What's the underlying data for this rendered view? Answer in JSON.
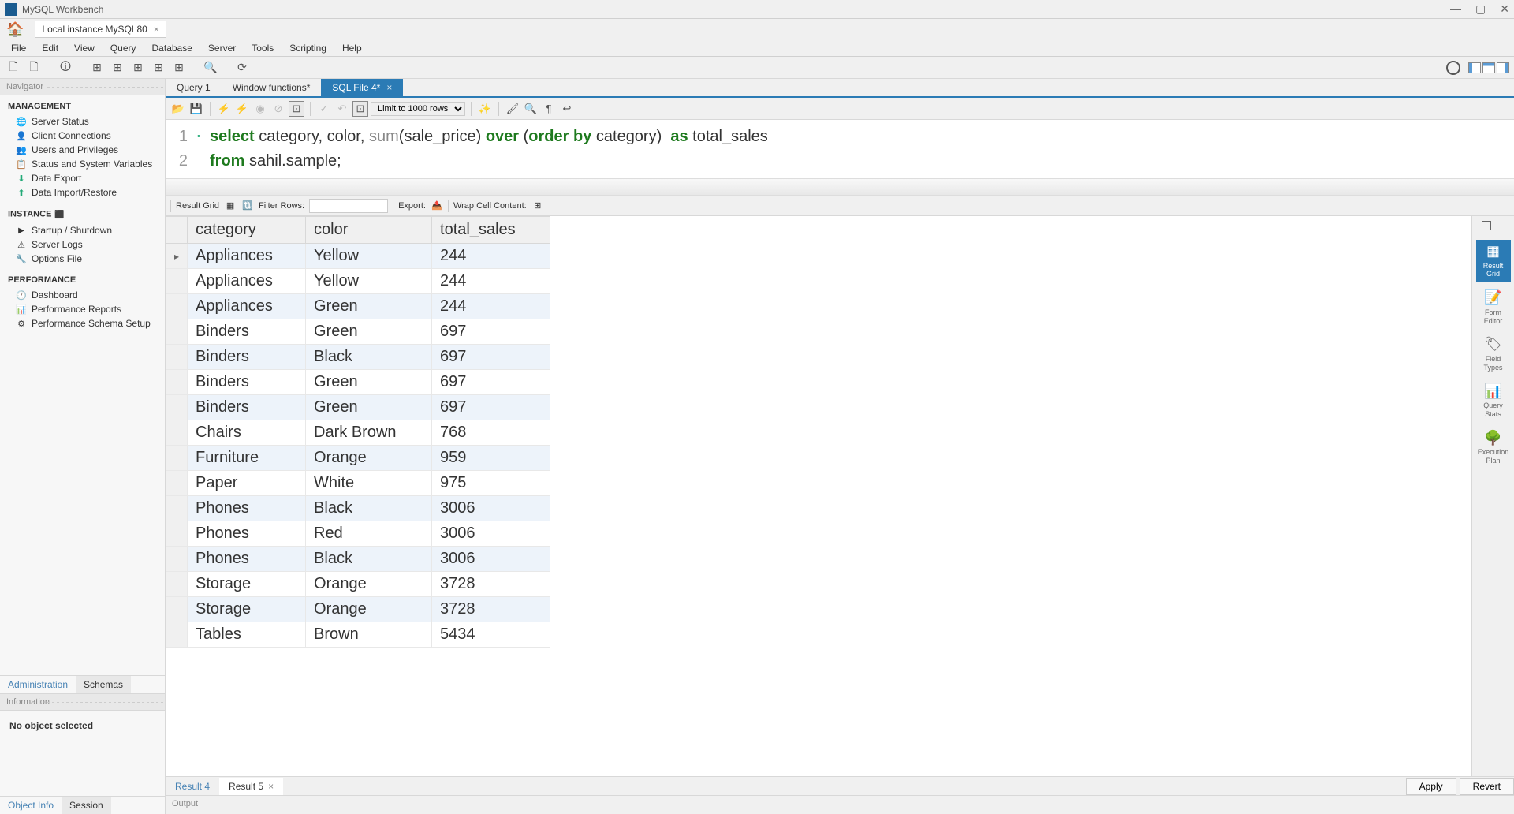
{
  "app": {
    "title": "MySQL Workbench",
    "connection_tab": "Local instance MySQL80"
  },
  "menu": [
    "File",
    "Edit",
    "View",
    "Query",
    "Database",
    "Server",
    "Tools",
    "Scripting",
    "Help"
  ],
  "navigator": {
    "title": "Navigator",
    "management": {
      "heading": "MANAGEMENT",
      "items": [
        {
          "label": "Server Status",
          "icon": "ico-status"
        },
        {
          "label": "Client Connections",
          "icon": "ico-conn"
        },
        {
          "label": "Users and Privileges",
          "icon": "ico-users"
        },
        {
          "label": "Status and System Variables",
          "icon": "ico-vars"
        },
        {
          "label": "Data Export",
          "icon": "ico-export"
        },
        {
          "label": "Data Import/Restore",
          "icon": "ico-import"
        }
      ]
    },
    "instance": {
      "heading": "INSTANCE",
      "items": [
        {
          "label": "Startup / Shutdown",
          "icon": "ico-startup"
        },
        {
          "label": "Server Logs",
          "icon": "ico-logs"
        },
        {
          "label": "Options File",
          "icon": "ico-options"
        }
      ]
    },
    "performance": {
      "heading": "PERFORMANCE",
      "items": [
        {
          "label": "Dashboard",
          "icon": "ico-dash"
        },
        {
          "label": "Performance Reports",
          "icon": "ico-perf"
        },
        {
          "label": "Performance Schema Setup",
          "icon": "ico-schema"
        }
      ]
    },
    "bottom_tabs": [
      "Administration",
      "Schemas"
    ],
    "info_title": "Information",
    "info_text": "No object selected",
    "info_tabs": [
      "Object Info",
      "Session"
    ]
  },
  "query_tabs": [
    {
      "label": "Query 1",
      "active": false
    },
    {
      "label": "Window functions*",
      "active": false
    },
    {
      "label": "SQL File 4*",
      "active": true
    }
  ],
  "editor": {
    "limit_label": "Limit to 1000 rows",
    "lines": [
      {
        "num": "1",
        "marker": "•",
        "tokens": [
          {
            "t": "select",
            "c": "kw"
          },
          {
            "t": " category, color, ",
            "c": "plain"
          },
          {
            "t": "sum",
            "c": "fn"
          },
          {
            "t": "(sale_price) ",
            "c": "plain"
          },
          {
            "t": "over",
            "c": "kw"
          },
          {
            "t": " (",
            "c": "plain"
          },
          {
            "t": "order by",
            "c": "kw"
          },
          {
            "t": " category)  ",
            "c": "plain"
          },
          {
            "t": "as",
            "c": "kw"
          },
          {
            "t": " total_sales",
            "c": "plain"
          }
        ]
      },
      {
        "num": "2",
        "marker": "",
        "tokens": [
          {
            "t": "from",
            "c": "kw"
          },
          {
            "t": " sahil.sample;",
            "c": "plain"
          }
        ]
      }
    ]
  },
  "result_toolbar": {
    "grid_label": "Result Grid",
    "filter_label": "Filter Rows:",
    "filter_value": "",
    "export_label": "Export:",
    "wrap_label": "Wrap Cell Content:"
  },
  "results": {
    "columns": [
      "category",
      "color",
      "total_sales"
    ],
    "rows": [
      [
        "Appliances",
        "Yellow",
        "244"
      ],
      [
        "Appliances",
        "Yellow",
        "244"
      ],
      [
        "Appliances",
        "Green",
        "244"
      ],
      [
        "Binders",
        "Green",
        "697"
      ],
      [
        "Binders",
        "Black",
        "697"
      ],
      [
        "Binders",
        "Green",
        "697"
      ],
      [
        "Binders",
        "Green",
        "697"
      ],
      [
        "Chairs",
        "Dark Brown",
        "768"
      ],
      [
        "Furniture",
        "Orange",
        "959"
      ],
      [
        "Paper",
        "White",
        "975"
      ],
      [
        "Phones",
        "Black",
        "3006"
      ],
      [
        "Phones",
        "Red",
        "3006"
      ],
      [
        "Phones",
        "Black",
        "3006"
      ],
      [
        "Storage",
        "Orange",
        "3728"
      ],
      [
        "Storage",
        "Orange",
        "3728"
      ],
      [
        "Tables",
        "Brown",
        "5434"
      ]
    ]
  },
  "side_panel": [
    {
      "label": "Result\nGrid",
      "active": true
    },
    {
      "label": "Form\nEditor",
      "active": false
    },
    {
      "label": "Field\nTypes",
      "active": false
    },
    {
      "label": "Query\nStats",
      "active": false
    },
    {
      "label": "Execution\nPlan",
      "active": false
    }
  ],
  "result_tabs": [
    {
      "label": "Result 4",
      "active": false
    },
    {
      "label": "Result 5",
      "active": true
    }
  ],
  "actions": {
    "apply": "Apply",
    "revert": "Revert"
  },
  "output": {
    "title": "Output"
  }
}
